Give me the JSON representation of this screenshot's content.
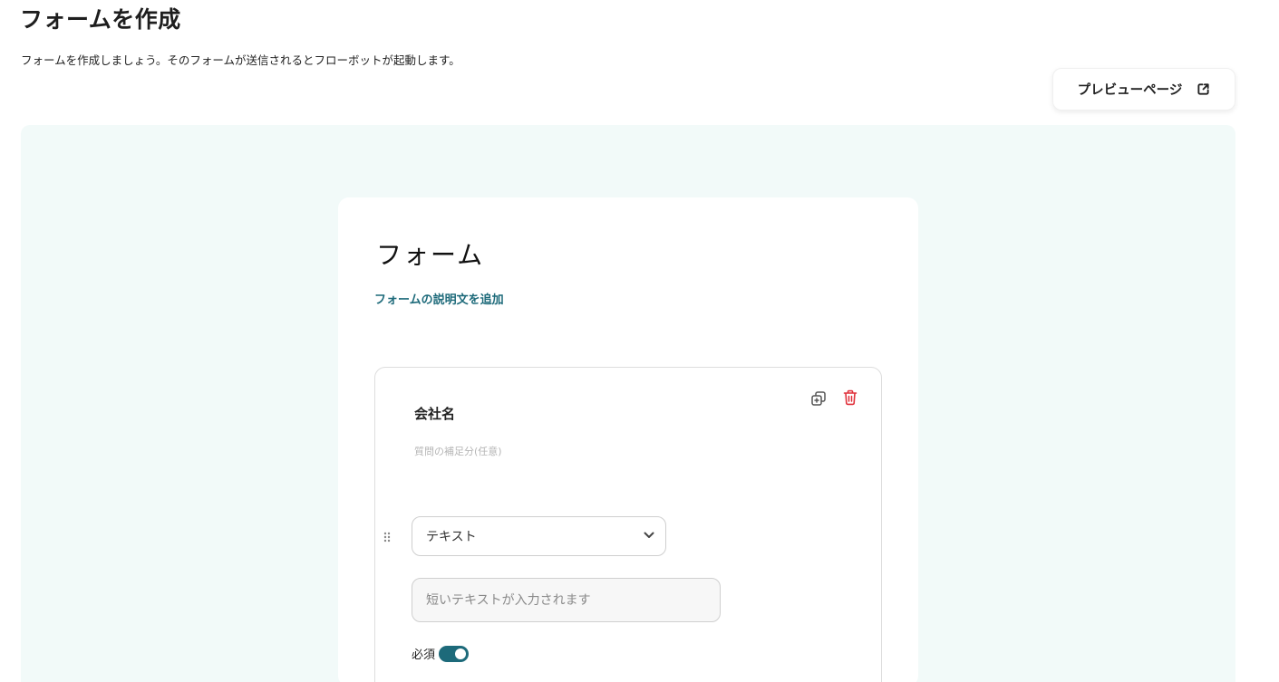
{
  "header": {
    "title": "フォームを作成",
    "description": "フォームを作成しましょう。そのフォームが送信されるとフローボットが起動します。"
  },
  "preview_button": {
    "label": "プレビューページ",
    "icon": "external-link-icon"
  },
  "form": {
    "title": "フォーム",
    "add_description_link": "フォームの説明文を追加",
    "questions": [
      {
        "title": "会社名",
        "hint_placeholder": "質問の補足分(任意)",
        "type_selected": "テキスト",
        "answer_placeholder": "短いテキストが入力されます",
        "required_label": "必須",
        "required": true,
        "icons": [
          "duplicate-icon",
          "trash-icon",
          "drag-handle-icon",
          "chevron-down-icon"
        ]
      }
    ]
  },
  "colors": {
    "accent": "#1d6a7a",
    "canvas_bg": "#f2faf9",
    "delete": "#e0303a"
  }
}
